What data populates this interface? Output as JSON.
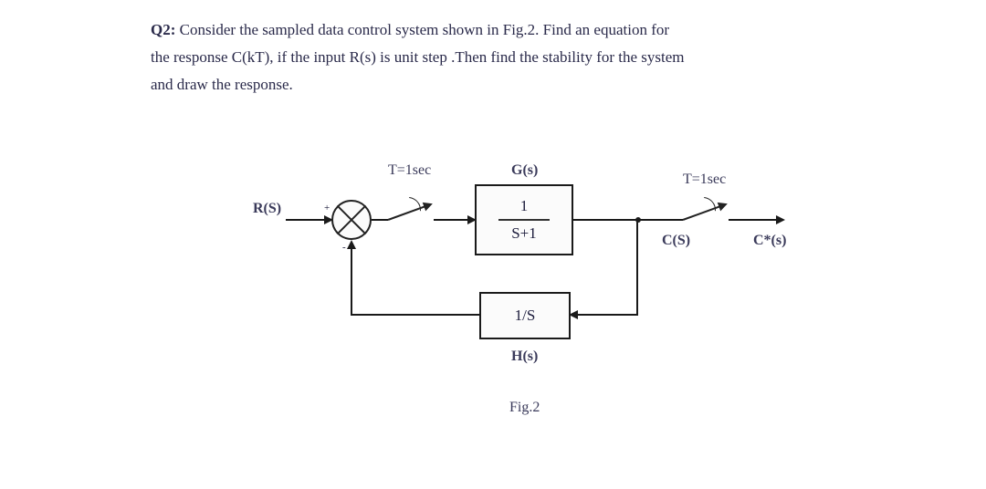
{
  "question": {
    "label": "Q2:",
    "text_line1": "Consider the sampled data control system shown in Fig.2. Find an equation for",
    "text_line2": "the response C(kT), if the input R(s) is unit step .Then find the stability for the system",
    "text_line3": "and draw the response."
  },
  "diagram": {
    "input": "R(S)",
    "sign_plus": "+",
    "sign_minus": "-",
    "sampler1_label": "T=1sec",
    "g_label": "G(s)",
    "g_num": "1",
    "g_den": "S+1",
    "output": "C(S)",
    "sampler2_label": "T=1sec",
    "output_star": "C*(s)",
    "h_block": "1/S",
    "h_label": "H(s)",
    "fig_caption": "Fig.2"
  }
}
